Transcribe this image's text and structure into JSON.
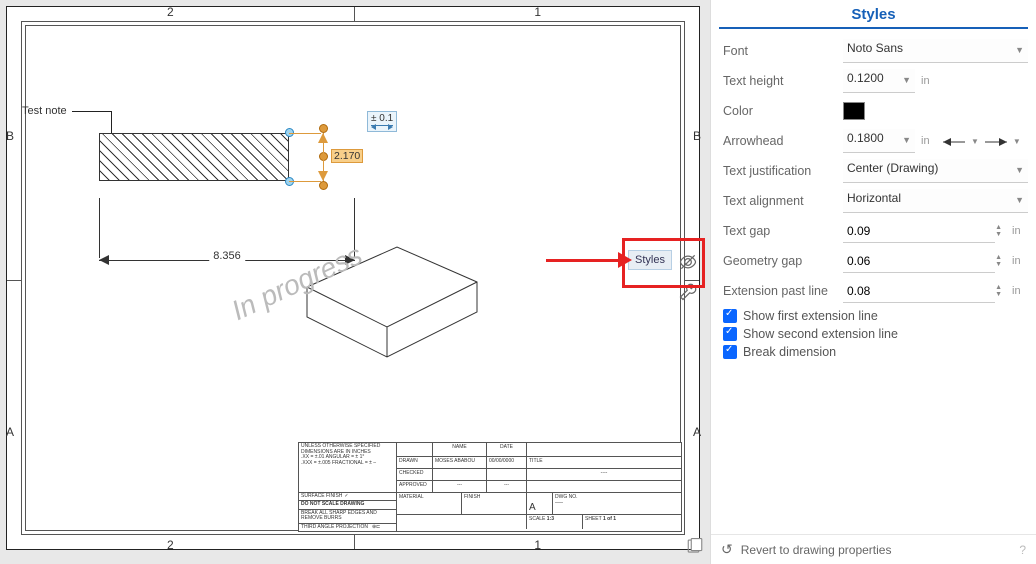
{
  "drawing": {
    "grid": {
      "col_left": "2",
      "col_right": "1",
      "row_top": "B",
      "row_bottom": "A"
    },
    "note": "Test note",
    "dim_horizontal": "8.356",
    "dim_vertical": "2.170",
    "tolerance_badge": "± 0.1",
    "watermark": "In progress",
    "styles_button_label": "Styles",
    "titleblock": {
      "spec1": "UNLESS OTHERWISE SPECIFIED",
      "spec2": "DIMENSIONS ARE IN INCHES",
      "spec3": ".XX = ±.01     ANGULAR = ± 1°",
      "spec4": ".XXX = ±.005    FRACTIONAL = ± –",
      "surface": "SURFACE FINISH",
      "noscale": "DO NOT SCALE DRAWING",
      "break": "BREAK ALL SHARP EDGES AND REMOVE BURRS",
      "proj": "THIRD ANGLE PROJECTION",
      "drawn": "DRAWN",
      "checked": "CHECKED",
      "approved": "APPROVED",
      "name": "NAME",
      "date": "DATE",
      "drawn_by": "MOSES ABABOU",
      "drawn_date": "00/00/0000",
      "title_lbl": "TITLE",
      "material": "MATERIAL",
      "finish": "FINISH",
      "size": "A",
      "dwgno": "DWG NO.",
      "scale_lbl": "SCALE",
      "scale_val": "1:3",
      "sheet_lbl": "SHEET",
      "sheet_val": "1 of 1",
      "dash": "----"
    }
  },
  "styles_panel": {
    "title": "Styles",
    "font": {
      "label": "Font",
      "value": "Noto Sans"
    },
    "text_height": {
      "label": "Text height",
      "value": "0.1200",
      "unit": "in"
    },
    "color": {
      "label": "Color",
      "hex": "#000000"
    },
    "arrowhead": {
      "label": "Arrowhead",
      "value": "0.1800",
      "unit": "in"
    },
    "text_justification": {
      "label": "Text justification",
      "value": "Center (Drawing)"
    },
    "text_alignment": {
      "label": "Text alignment",
      "value": "Horizontal"
    },
    "text_gap": {
      "label": "Text gap",
      "value": "0.09",
      "unit": "in"
    },
    "geometry_gap": {
      "label": "Geometry gap",
      "value": "0.06",
      "unit": "in"
    },
    "extension_past_line": {
      "label": "Extension past line",
      "value": "0.08",
      "unit": "in"
    },
    "cb1": "Show first extension line",
    "cb2": "Show second extension line",
    "cb3": "Break dimension",
    "footer": "Revert to drawing properties"
  }
}
